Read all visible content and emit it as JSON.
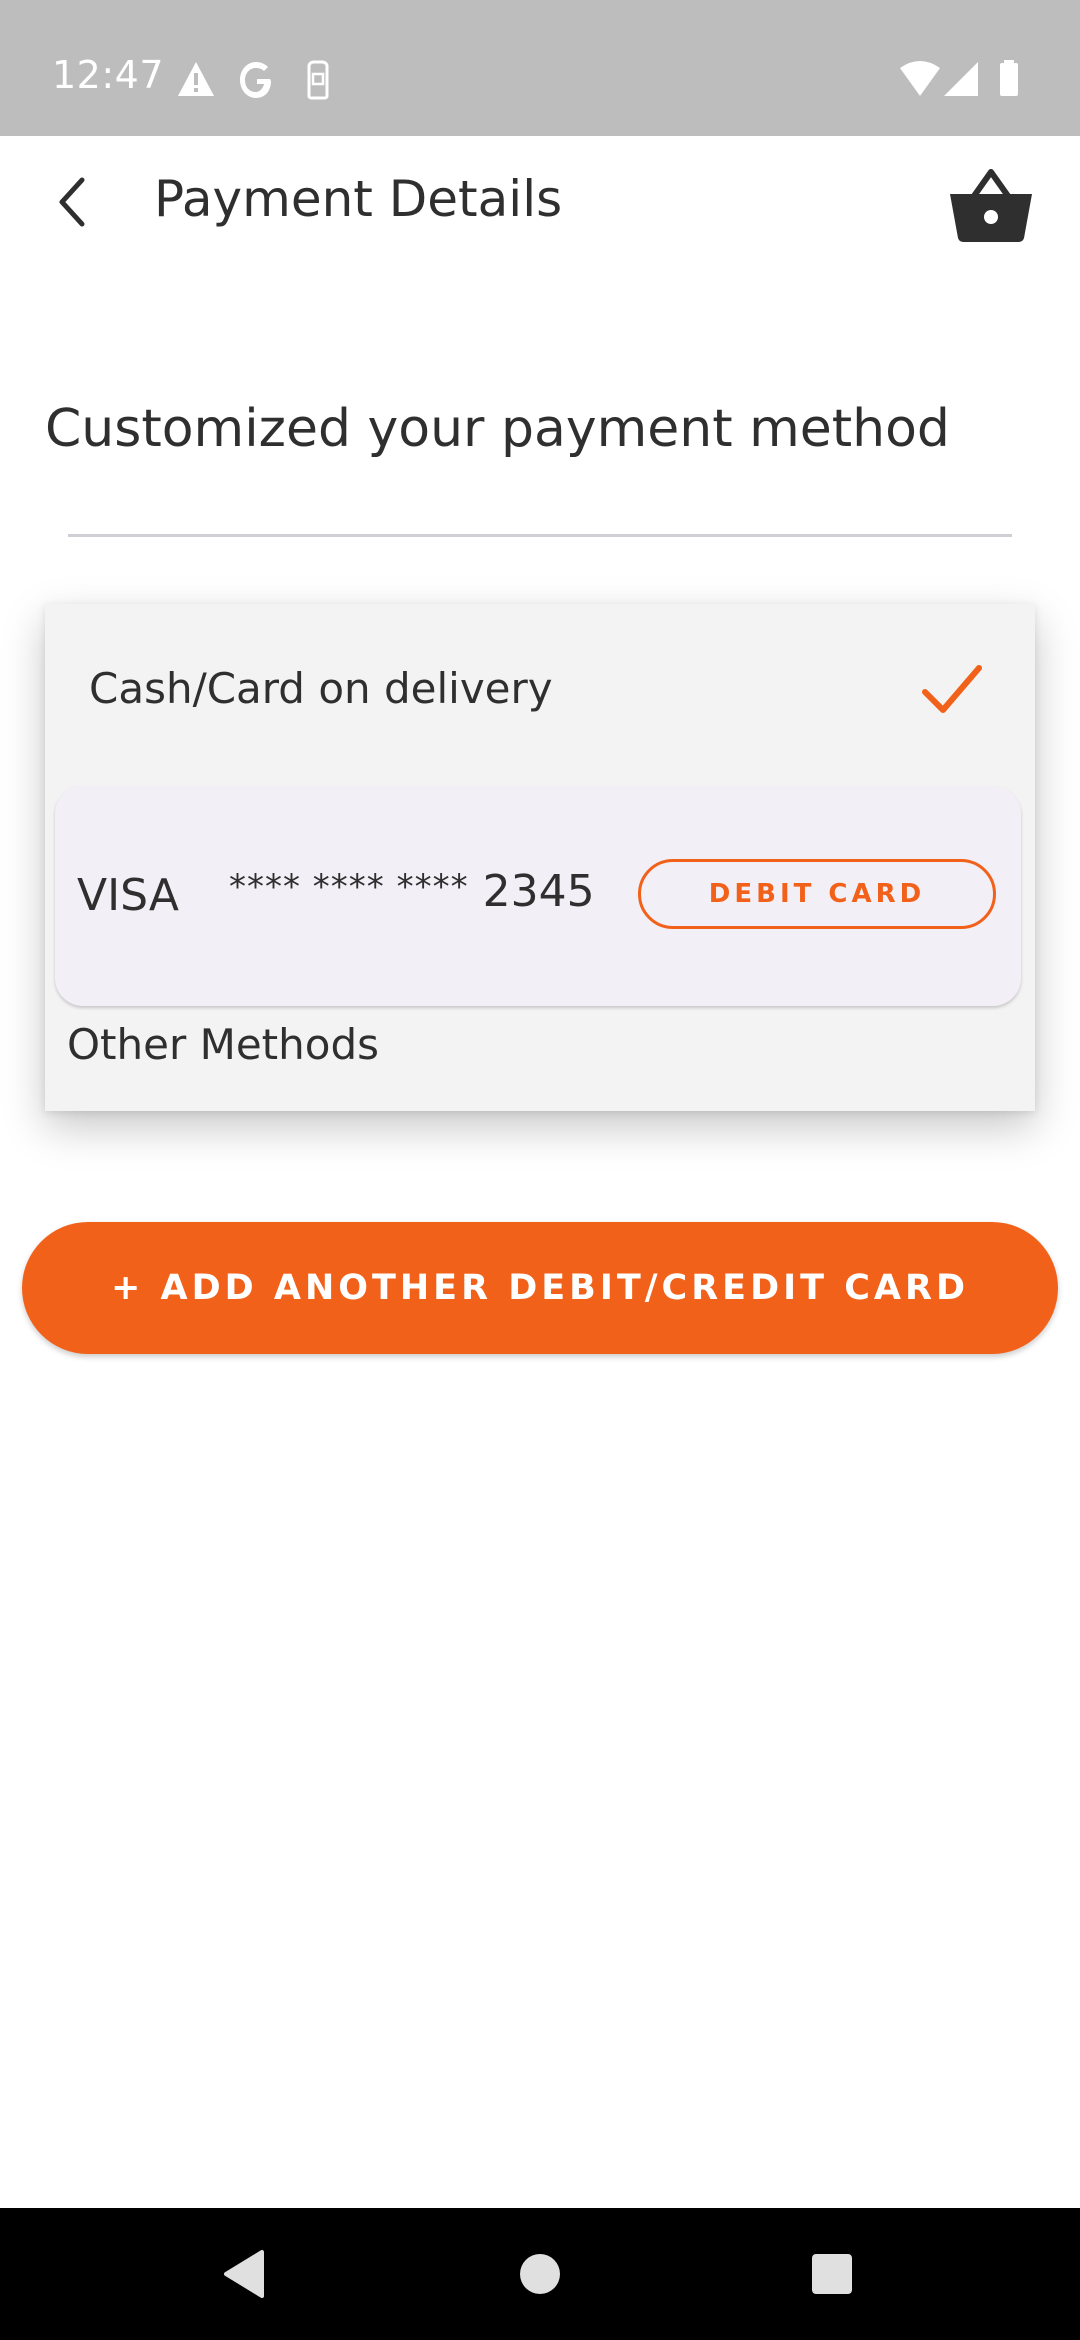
{
  "status_bar": {
    "time": "12:47",
    "left_icons": [
      "warning-icon",
      "google-icon",
      "sim-icon"
    ],
    "right_icons": [
      "wifi-icon",
      "signal-icon",
      "battery-icon"
    ]
  },
  "app_bar": {
    "title": "Payment Details",
    "back_icon": "chevron-left-icon",
    "cart_icon": "basket-icon"
  },
  "heading": "Customized your payment method",
  "payment_methods": {
    "cash_on_delivery": {
      "label": "Cash/Card on delivery",
      "selected": true
    },
    "saved_card": {
      "brand": "VISA",
      "masked": "**** **** ****",
      "last4": "2345",
      "type_label": "DEBIT CARD"
    },
    "other_methods_label": "Other Methods"
  },
  "add_card_button": "+ ADD ANOTHER DEBIT/CREDIT CARD",
  "colors": {
    "accent": "#f26119",
    "text": "#2f2f2f",
    "status_bar": "#bdbdbd",
    "card_background": "#f3f3f3",
    "saved_card_background": "#f2eff6",
    "nav_bar": "#000000"
  },
  "nav_bar": {
    "icons": [
      "back-triangle-icon",
      "home-circle-icon",
      "recents-square-icon"
    ]
  }
}
